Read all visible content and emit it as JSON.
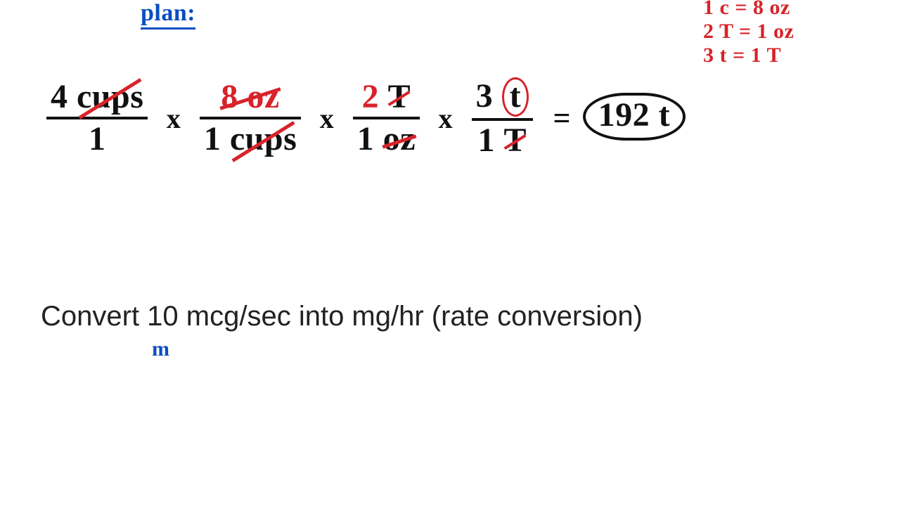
{
  "plan_label": "plan:",
  "notes": {
    "line1": "1 c = 8 oz",
    "line2": "2 T = 1 oz",
    "line3": "3 t = 1 T"
  },
  "eq": {
    "f1": {
      "num_val": "4",
      "num_unit": "cups",
      "den": "1"
    },
    "f2": {
      "num_val": "8",
      "num_unit": "oz",
      "den_val": "1",
      "den_unit": "cups"
    },
    "f3": {
      "num_val": "2",
      "num_unit": "T",
      "den_val": "1",
      "den_unit": "oz"
    },
    "f4": {
      "num_val": "3",
      "num_unit": "t",
      "den_val": "1",
      "den_unit": "T"
    },
    "times": "x",
    "equals": "=",
    "result": "192 t"
  },
  "problem": "Convert 10 mcg/sec into mg/hr  (rate conversion)",
  "annotation_m": "m"
}
